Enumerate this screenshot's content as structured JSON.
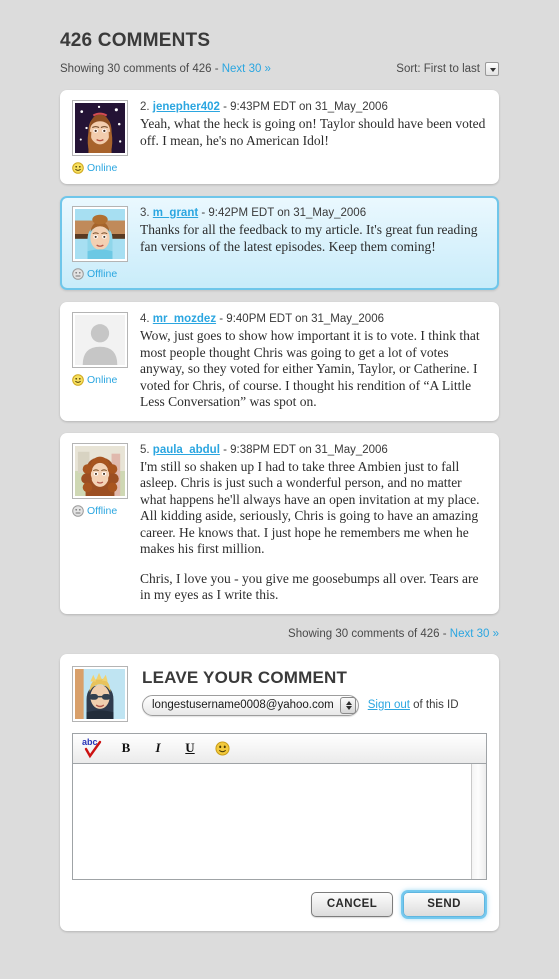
{
  "header": {
    "title": "426 COMMENTS",
    "showing_prefix": "Showing 30 comments of 426 - ",
    "next_link": "Next 30 »",
    "sort_label": "Sort: First to last"
  },
  "comments": [
    {
      "num": "2.",
      "user": "jenepher402",
      "meta": "-  9:43PM EDT on 31_May_2006",
      "status": "Online",
      "status_type": "online",
      "avatar": "starry-purple-auburn",
      "highlight": false,
      "paragraphs": [
        "Yeah, what the heck is going on! Taylor should have been voted off. I mean, he's no American Idol!"
      ]
    },
    {
      "num": "3.",
      "user": "m_grant",
      "meta": "-  9:42PM EDT on 31_May_2006",
      "status": "Offline",
      "status_type": "offline",
      "avatar": "blue-updo",
      "highlight": true,
      "paragraphs": [
        "Thanks for all the feedback to my article. It's great fun reading fan versions of the latest episodes. Keep them coming!"
      ]
    },
    {
      "num": "4.",
      "user": "mr_mozdez",
      "meta": "-  9:40PM EDT on 31_May_2006",
      "status": "Online",
      "status_type": "online",
      "avatar": "default-silhouette",
      "highlight": false,
      "paragraphs": [
        "Wow, just goes to show how important it is to vote. I think that most people thought Chris was going to get a lot of votes anyway, so they voted for either Yamin, Taylor, or Catherine. I voted for Chris, of course. I thought his rendition of “A Little Less Conversation” was spot on."
      ]
    },
    {
      "num": "5.",
      "user": "paula_abdul",
      "meta": "-  9:38PM EDT on 31_May_2006",
      "status": "Offline",
      "status_type": "offline",
      "avatar": "curly-auburn",
      "highlight": false,
      "paragraphs": [
        "I'm still so shaken up I had to take three Ambien just to fall asleep. Chris is just such a wonderful person, and no matter what happens he'll always have an open invitation at my place. All kidding aside, seriously, Chris is going to have an amazing career. He knows that. I just hope he remembers me when he makes his first million.",
        "Chris, I love you - you give me goosebumps all over. Tears are in my eyes as I write this."
      ]
    }
  ],
  "footer": {
    "showing_prefix": "Showing 30 comments of 426 - ",
    "next_link": "Next 30 »"
  },
  "form": {
    "title": "LEAVE YOUR COMMENT",
    "avatar": "blond-sunglasses",
    "account_email": "longestusername0008@yahoo.com",
    "signout_link": "Sign out",
    "signout_suffix": " of this ID",
    "toolbar": {
      "spellcheck_label": "abc",
      "bold_label": "B",
      "italic_label": "I",
      "underline_label": "U",
      "emoticon_label": "☺"
    },
    "textarea_value": "",
    "textarea_placeholder": "",
    "cancel_label": "CANCEL",
    "send_label": "SEND"
  },
  "colors": {
    "page_bg": "#dcdcdc",
    "card_bg": "#ffffff",
    "link": "#2ba6e0",
    "highlight_border": "#6fc6ea",
    "highlight_bg": "#c9ecfa",
    "text": "#2c2c2c",
    "online": "#f5d23c",
    "offline": "#bdbdbd"
  }
}
